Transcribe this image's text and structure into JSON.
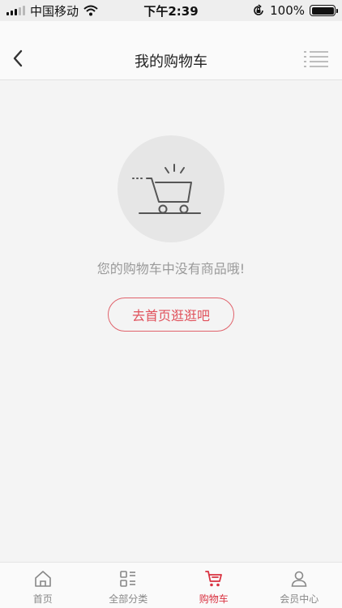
{
  "status_bar": {
    "carrier": "中国移动",
    "time": "下午2:39",
    "battery": "100%"
  },
  "header": {
    "title": "我的购物车",
    "back_icon": "chevron-left-icon",
    "menu_icon": "list-menu-icon"
  },
  "empty_state": {
    "icon": "shopping-cart-icon",
    "message": "您的购物车中没有商品哦!",
    "action_label": "去首页逛逛吧"
  },
  "tabs": [
    {
      "label": "首页",
      "icon": "home-icon",
      "active": false
    },
    {
      "label": "全部分类",
      "icon": "category-icon",
      "active": false
    },
    {
      "label": "购物车",
      "icon": "cart-icon",
      "active": true
    },
    {
      "label": "会员中心",
      "icon": "user-icon",
      "active": false
    }
  ],
  "colors": {
    "accent": "#d93240",
    "button_border": "#e0626b",
    "muted_text": "#9a9a9a"
  }
}
